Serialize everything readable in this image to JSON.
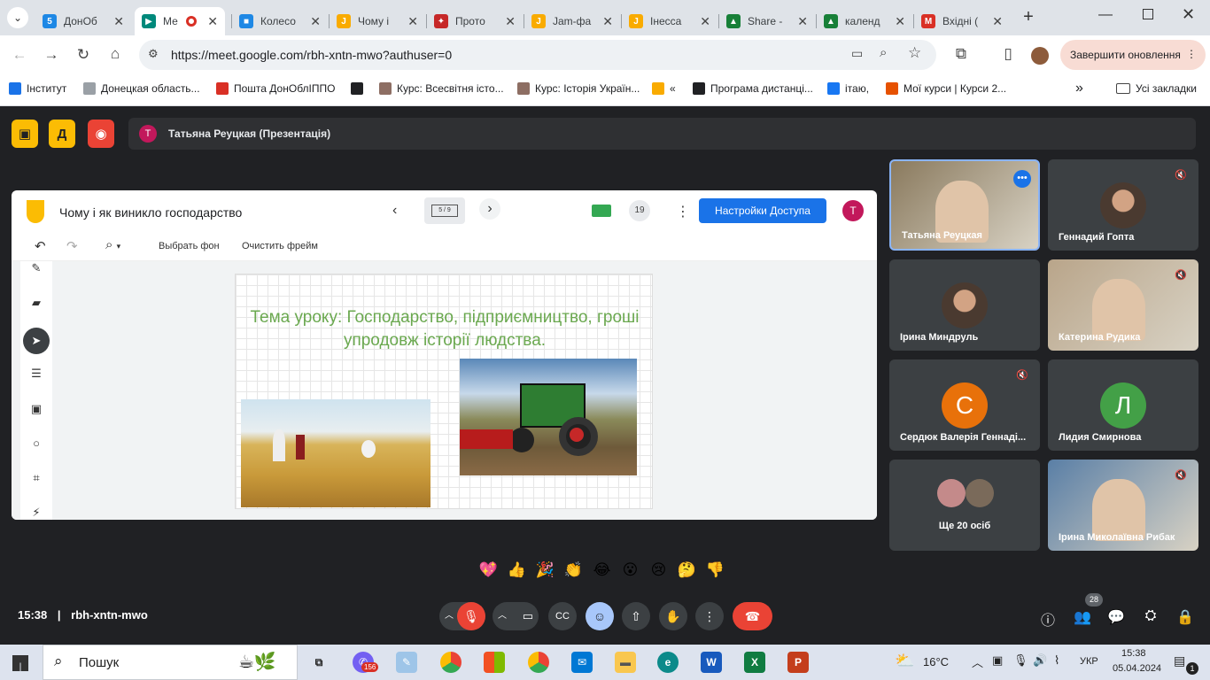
{
  "browser": {
    "tabs": [
      {
        "label": "ДонОб",
        "color": "#1e88e5",
        "glyph": "5"
      },
      {
        "label": "Ме",
        "color": "#00897b",
        "glyph": "▶"
      },
      {
        "label": "Колесо",
        "color": "#1e88e5",
        "glyph": "■"
      },
      {
        "label": "Чому і",
        "color": "#f9ab00",
        "glyph": "J"
      },
      {
        "label": "Прото",
        "color": "#c62828",
        "glyph": "✦"
      },
      {
        "label": "Jam-фа",
        "color": "#f9ab00",
        "glyph": "J"
      },
      {
        "label": "Інесса",
        "color": "#f9ab00",
        "glyph": "J"
      },
      {
        "label": "Share -",
        "color": "#188038",
        "glyph": "▲"
      },
      {
        "label": "календ",
        "color": "#188038",
        "glyph": "▲"
      },
      {
        "label": "Вхідні (",
        "color": "#d93025",
        "glyph": "M"
      }
    ],
    "url": "https://meet.google.com/rbh-xntn-mwo?authuser=0",
    "update_button": "Завершити оновлення",
    "bookmarks": [
      {
        "label": "Інститут",
        "color": "#1a73e8"
      },
      {
        "label": "Донецкая область...",
        "color": "#9aa0a6"
      },
      {
        "label": "Пошта ДонОблІППО",
        "color": "#d93025"
      },
      {
        "label": "",
        "color": "#202124"
      },
      {
        "label": "Курс: Всесвітня істо...",
        "color": "#8d6e63"
      },
      {
        "label": "Курс: Історія Україн...",
        "color": "#8d6e63"
      },
      {
        "label": "«",
        "color": "#f9ab00"
      },
      {
        "label": "Програма дистанці...",
        "color": "#202124"
      },
      {
        "label": "ітаю,",
        "color": "#1877f2"
      },
      {
        "label": "Мої курси | Курси 2...",
        "color": "#e65100"
      }
    ],
    "all_bookmarks": "Усі закладки",
    "more_bookmarks": "»"
  },
  "meet": {
    "presenter_initial": "Т",
    "presenter_bar": "Татьяна Реуцкая (Презентація)",
    "jamboard": {
      "title": "Чому і як виникло господарство",
      "frame_counter": "5 / 9",
      "viewer_count": "19",
      "share_button": "Настройки Доступа",
      "user_initial": "Т",
      "set_background": "Выбрать фон",
      "clear_frame": "Очистить фрейм",
      "slide_title": "Тема уроку: Господарство, підприємництво, гроші упродовж історії людства."
    },
    "participants": [
      {
        "name": "Татьяна Реуцкая",
        "type": "video",
        "bg": "#8a7a5e"
      },
      {
        "name": "Геннадий Гопта",
        "type": "photo",
        "bg": "#3c4043",
        "muted": true
      },
      {
        "name": "Ірина Миндруль",
        "type": "photo",
        "bg": "#3c4043"
      },
      {
        "name": "Катерина Рудика",
        "type": "video",
        "bg": "#b9a58a",
        "muted": true
      },
      {
        "name": "Сердюк Валерія Геннаді...",
        "type": "letter",
        "letter": "С",
        "color": "#e8710a",
        "muted": true
      },
      {
        "name": "Лидия Смирнова",
        "type": "letter",
        "letter": "Л",
        "color": "#43a047"
      },
      {
        "name": "Ще 20 осіб",
        "type": "group"
      },
      {
        "name": "Ірина Миколаївна Рибак",
        "type": "video",
        "bg": "#5a7fa6",
        "muted": true
      }
    ],
    "reactions": [
      "💖",
      "👍",
      "🎉",
      "👏",
      "😂",
      "😮",
      "😢",
      "🤔",
      "👎"
    ],
    "time": "15:38",
    "meeting_code": "rbh-xntn-mwo",
    "participant_count": "28"
  },
  "taskbar": {
    "search_label": "Пошук",
    "mail_badge": "156",
    "weather": "16°C",
    "language": "УКР",
    "clock_time": "15:38",
    "clock_date": "05.04.2024",
    "notif_count": "1"
  }
}
